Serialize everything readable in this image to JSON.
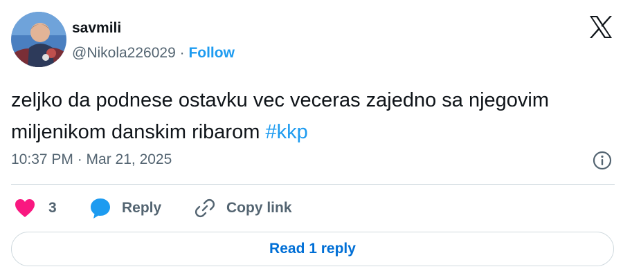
{
  "author": {
    "display_name": "savmili",
    "handle": "@Nikola226029",
    "separator": "·",
    "follow_label": "Follow"
  },
  "tweet": {
    "text": "zeljko da podnese ostavku vec veceras zajedno sa njegovim miljenikom danskim ribarom ",
    "hashtag": "#kkp",
    "timestamp": "10:37 PM · Mar 21, 2025"
  },
  "actions": {
    "like_count": "3",
    "reply_label": "Reply",
    "copy_link_label": "Copy link"
  },
  "read_replies_label": "Read 1 reply",
  "colors": {
    "accent": "#1d9bf0",
    "like": "#f91880",
    "secondary_text": "#536471",
    "read_button_text": "#006fd6"
  },
  "icons": [
    "x-logo-icon",
    "info-icon",
    "heart-icon",
    "reply-bubble-icon",
    "link-icon"
  ]
}
